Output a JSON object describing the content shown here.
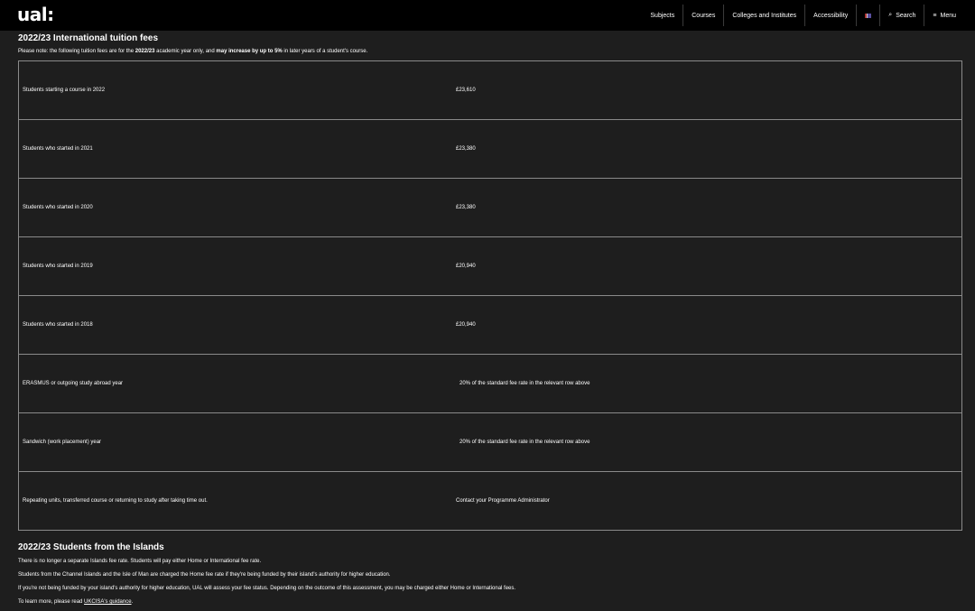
{
  "header": {
    "logo": "ual:",
    "nav": {
      "subjects": "Subjects",
      "courses": "Courses",
      "colleges": "Colleges and Institutes",
      "accessibility": "Accessibility",
      "search": "Search",
      "menu": "Menu"
    },
    "icons": [
      "uk-flag-icon",
      "search-icon",
      "menu-icon"
    ]
  },
  "intl": {
    "title": "2022/23 International tuition fees",
    "note_prefix": "Please note: the following tuition fees are for the ",
    "note_year": "2022/23",
    "note_mid": " academic year only, and ",
    "note_increase": "may increase by up to 5%",
    "note_suffix": " in later years of a student's course.",
    "rows": [
      {
        "label": "Students starting a course in 2022",
        "value": "£23,610"
      },
      {
        "label": "Students who started in 2021",
        "value": "£23,380"
      },
      {
        "label": "Students who started in 2020",
        "value": "£23,380"
      },
      {
        "label": "Students who started in 2019",
        "value": "£20,940"
      },
      {
        "label": "Students who started in 2018",
        "value": "£20,940"
      },
      {
        "label": "ERASMUS or outgoing study abroad year",
        "value": "20% of the standard fee rate in the relevant row above"
      },
      {
        "label": "Sandwich (work placement) year",
        "value": "20% of the standard fee rate in the relevant row above"
      },
      {
        "label": "Repeating units, transferred course or returning to study after taking time out.",
        "value": "Contact your Programme Administrator"
      }
    ]
  },
  "islands": {
    "title": "2022/23 Students from the Islands",
    "p1": "There is no longer a separate Islands fee rate. Students will pay either Home or International fee rate.",
    "p2": "Students from the Channel Islands and the Isle of Man are charged the Home fee rate if they're being funded by their island's authority for higher education.",
    "p3": "If you're not being funded by your island's authority for higher education, UAL will assess your fee status. Depending on the outcome of this assessment, you may be charged either Home or International fees.",
    "p4_prefix": "To learn more, please read ",
    "p4_link": "UKCISA's guidance",
    "p4_suffix": "."
  }
}
